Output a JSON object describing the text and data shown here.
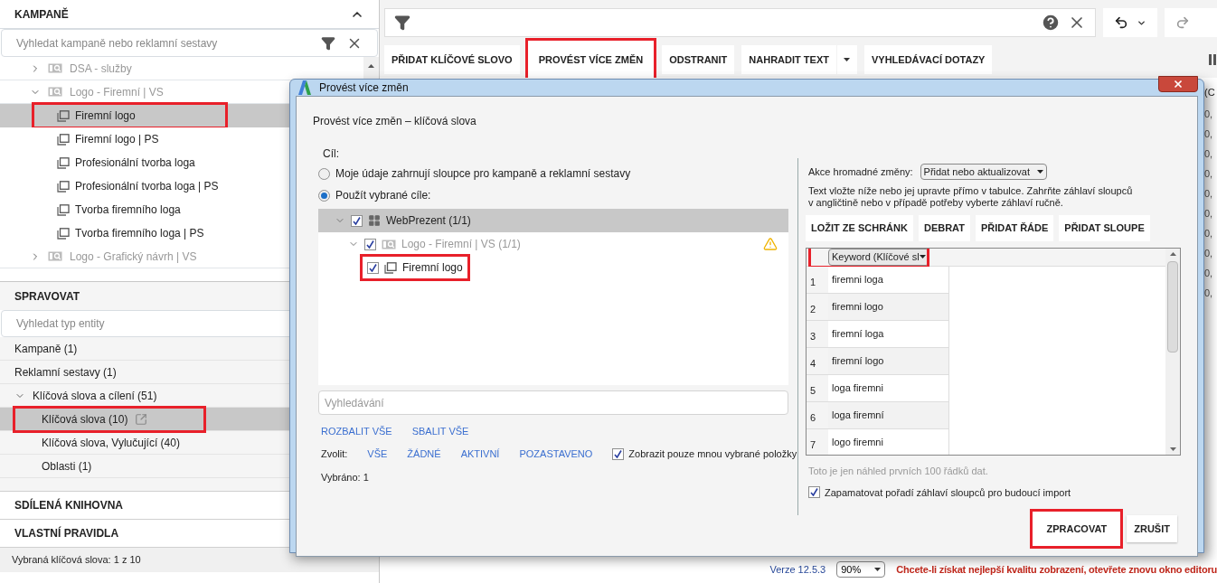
{
  "sidebar": {
    "campaigns": {
      "title": "KAMPANĚ",
      "search": {
        "placeholder": "Vyhledat kampaně nebo reklamní sestavy"
      },
      "tree": [
        {
          "label": "DSA - služby",
          "expanded": false
        },
        {
          "label": "Logo - Firemní | VS",
          "expanded": true,
          "children": [
            {
              "label": "Firemní logo",
              "selected": true,
              "highlighted": true
            },
            {
              "label": "Firemní logo | PS",
              "selected": false,
              "highlighted": false
            },
            {
              "label": "Profesionální tvorba loga",
              "selected": false,
              "highlighted": false
            },
            {
              "label": "Profesionální tvorba loga | PS",
              "selected": false,
              "highlighted": false
            },
            {
              "label": "Tvorba firemního loga",
              "selected": false,
              "highlighted": false
            },
            {
              "label": "Tvorba firemního loga | PS",
              "selected": false,
              "highlighted": false
            }
          ]
        },
        {
          "label": "Logo - Grafický návrh | VS",
          "expanded": false
        }
      ]
    },
    "manage": {
      "title": "SPRAVOVAT",
      "search": {
        "placeholder": "Vyhledat typ entity"
      },
      "items": [
        {
          "label": "Kampaně (1)",
          "selected": false,
          "highlighted": false,
          "open_icon": false
        },
        {
          "label": "Reklamní sestavy (1)",
          "selected": false,
          "highlighted": false,
          "open_icon": false
        },
        {
          "label": "Klíčová slova a cílení (51)",
          "selected": false,
          "highlighted": false,
          "open_icon": false,
          "expanded": true,
          "children": [
            {
              "label": "Klíčová slova (10)",
              "selected": true,
              "highlighted": true,
              "open_icon": true
            },
            {
              "label": "Klíčová slova, Vylučující (40)",
              "selected": false,
              "highlighted": false,
              "open_icon": false
            },
            {
              "label": "Oblasti (1)",
              "selected": false,
              "highlighted": false,
              "open_icon": false
            }
          ]
        }
      ]
    },
    "sections": [
      "SDÍLENÁ KNIHOVNA",
      "VLASTNÍ PRAVIDLA"
    ],
    "status": "Vybraná klíčová slova: 1 z 10"
  },
  "toolbar": {
    "buttons": [
      {
        "label": "PŘIDAT KLÍČOVÉ SLOVO",
        "highlighted": false,
        "dropdown": false
      },
      {
        "label": "PROVÉST VÍCE ZMĚN",
        "highlighted": true,
        "dropdown": false
      },
      {
        "label": "ODSTRANIT",
        "highlighted": false,
        "dropdown": false
      },
      {
        "label": "NAHRADIT TEXT",
        "highlighted": false,
        "dropdown": true
      },
      {
        "label": "VYHLEDÁVACÍ DOTAZY",
        "highlighted": false,
        "dropdown": false
      }
    ]
  },
  "background_table": {
    "header": "(C",
    "cells": [
      "0,",
      "0,",
      "0,",
      "0,",
      "0,",
      "0,",
      "0,",
      "0,",
      "0,",
      "0,"
    ]
  },
  "footer": {
    "version": "Verze 12.5.3",
    "zoom": "90%",
    "message": "Chcete-li získat nejlepší kvalitu zobrazení, otevřete znovu okno editoru"
  },
  "dialog": {
    "title": "Provést více změn",
    "heading": "Provést více změn – klíčová slova",
    "target_label": "Cíl:",
    "options": [
      {
        "label": "Moje údaje zahrnují sloupce pro kampaně a reklamní sestavy",
        "selected": false
      },
      {
        "label": "Použít vybrané cíle:",
        "selected": true
      }
    ],
    "tree": [
      {
        "label": "WebPrezent (1/1)",
        "kind": "account",
        "checked": true,
        "selected": true,
        "warning": false,
        "highlighted": false,
        "children": [
          {
            "label": "Logo - Firemní | VS (1/1)",
            "kind": "campaign",
            "checked": true,
            "selected": false,
            "warning": true,
            "highlighted": false,
            "children": [
              {
                "label": "Firemní logo",
                "kind": "ad-group",
                "checked": true,
                "selected": false,
                "warning": false,
                "highlighted": true
              }
            ]
          }
        ]
      }
    ],
    "search": {
      "placeholder": "Vyhledávání"
    },
    "expand_links": [
      "ROZBALIT VŠE",
      "SBALIT VŠE"
    ],
    "select_label": "Zvolit:",
    "select_links": [
      "VŠE",
      "ŽÁDNÉ",
      "AKTIVNÍ",
      "POZASTAVENO"
    ],
    "show_selected": {
      "label": "Zobrazit pouze mnou vybrané položky",
      "checked": true
    },
    "selected_count": "Vybráno: 1",
    "action_label": "Akce hromadné změny:",
    "action_value": "Přidat nebo aktualizovat",
    "instructions": "Text vložte níže nebo jej upravte přímo v tabulce. Zahrňte záhlaví sloupců v angličtině nebo v případě potřeby vyberte záhlaví ručně.",
    "grid_buttons": [
      "LOŽIT ZE SCHRÁNK",
      "DEBRAT",
      "PŘIDAT ŘÁDE",
      "PŘIDAT SLOUPE"
    ],
    "grid": {
      "column": {
        "label": "Keyword (Klíčové sl",
        "highlighted": true
      },
      "rows": [
        {
          "number": "1",
          "value": "firemni loga"
        },
        {
          "number": "2",
          "value": "firemni logo"
        },
        {
          "number": "3",
          "value": "firemní loga"
        },
        {
          "number": "4",
          "value": "firemní logo"
        },
        {
          "number": "5",
          "value": "loga firemni"
        },
        {
          "number": "6",
          "value": "loga firemní"
        },
        {
          "number": "7",
          "value": "logo firemni"
        }
      ]
    },
    "note": "Toto je jen náhled prvních 100 řádků dat.",
    "remember": {
      "label": "Zapamatovat pořadí záhlaví sloupců pro budoucí import",
      "checked": true
    },
    "actions": [
      {
        "label": "ZPRACOVAT",
        "highlighted": true
      },
      {
        "label": "ZRUŠIT",
        "highlighted": false
      }
    ]
  }
}
